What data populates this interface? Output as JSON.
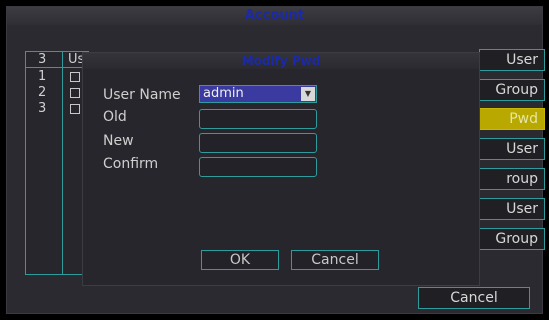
{
  "account": {
    "title": "Account",
    "table": {
      "header_count": "3",
      "header_user": "Us",
      "rows": [
        "1",
        "2",
        "3"
      ]
    },
    "side_buttons": [
      "User",
      "Group",
      "Pwd",
      "User",
      "roup",
      "User",
      "Group"
    ],
    "active_side_button": 2,
    "cancel_label": "Cancel"
  },
  "dialog": {
    "title": "Modify Pwd",
    "user_name_label": "User Name",
    "user_name_value": "admin",
    "old_label": "Old",
    "new_label": "New",
    "confirm_label": "Confirm",
    "ok_label": "OK",
    "cancel_label": "Cancel"
  },
  "colors": {
    "title_text": "#1a2aa8",
    "border_accent": "#2e9c9c",
    "active_button": "#b8a800",
    "select_bg": "#3a3aa0"
  }
}
